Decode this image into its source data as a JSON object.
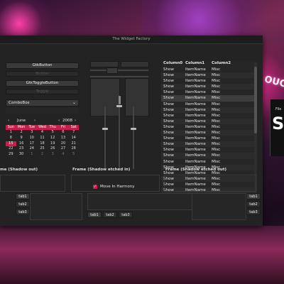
{
  "window": {
    "title": "The Widget Factory"
  },
  "buttons": {
    "gtkbutton": "GtkButton",
    "disabled_button": "Button",
    "togglebutton": "GtkToggleButton",
    "disabled_toggle": "Toggle"
  },
  "combobox": {
    "value": "ComboBox"
  },
  "calendar": {
    "month": "June",
    "year": "2008",
    "prev": "‹",
    "next": "›",
    "days": [
      "Sun",
      "Mon",
      "Tue",
      "Wed",
      "Thu",
      "Fri",
      "Sat"
    ],
    "weeks": [
      [
        "1",
        "2",
        "3",
        "4",
        "5",
        "6",
        "7"
      ],
      [
        "8",
        "9",
        "10",
        "11",
        "12",
        "13",
        "14"
      ],
      [
        "15",
        "16",
        "17",
        "18",
        "19",
        "20",
        "21"
      ],
      [
        "22",
        "23",
        "24",
        "25",
        "26",
        "27",
        "28"
      ],
      [
        "29",
        "30",
        "1",
        "2",
        "3",
        "4",
        "5"
      ]
    ],
    "selected_day": "15"
  },
  "checkbox": {
    "label": "Move In Harmony",
    "checked": true
  },
  "treeview": {
    "headers": [
      "Column0",
      "Column1",
      "Column2"
    ],
    "rows": [
      [
        "Show",
        "ItemName",
        "Misc"
      ],
      [
        "Show",
        "ItemName",
        "Misc"
      ],
      [
        "Show",
        "ItemName",
        "Misc"
      ],
      [
        "Show",
        "ItemName",
        "Misc"
      ],
      [
        "Show",
        "ItemName",
        "Misc"
      ],
      [
        "Show",
        "ItemName",
        "Misc"
      ],
      [
        "Show",
        "ItemName",
        "Misc"
      ],
      [
        "Show",
        "ItemName",
        "Misc"
      ],
      [
        "Show",
        "ItemName",
        "Misc"
      ],
      [
        "Show",
        "ItemName",
        "Misc"
      ],
      [
        "Show",
        "ItemName",
        "Misc"
      ],
      [
        "Show",
        "ItemName",
        "Misc"
      ],
      [
        "Show",
        "ItemName",
        "Misc"
      ],
      [
        "Show",
        "ItemName",
        "Misc"
      ],
      [
        "Show",
        "ItemName",
        "Misc"
      ],
      [
        "Show",
        "ItemName",
        "Misc"
      ],
      [
        "Show",
        "ItemName",
        "Misc"
      ],
      [
        "Show",
        "ItemName",
        "Misc"
      ],
      [
        "Show",
        "ItemName",
        "Misc"
      ],
      [
        "Show",
        "ItemName",
        "Misc"
      ],
      [
        "Show",
        "ItemName",
        "Misc"
      ],
      [
        "Show",
        "ItemName",
        "Misc"
      ]
    ]
  },
  "frames": {
    "shadow_out": "me (Shadow out)",
    "etched_in": "Frame (Shadow etched in)",
    "etched_out": "Frame (Shadow etched out)"
  },
  "notebooks": {
    "left_tabs": [
      "tab1",
      "tab2",
      "tab3"
    ],
    "bottom_tabs": [
      "tab1",
      "tab2",
      "tab3"
    ],
    "right_tabs": [
      "tab1",
      "tab2",
      "tab3"
    ]
  },
  "background": {
    "sign_text": "OUC",
    "side_big": "S",
    "side_file": "File"
  },
  "colors": {
    "accent": "#c2204d",
    "window_bg": "#232323"
  }
}
